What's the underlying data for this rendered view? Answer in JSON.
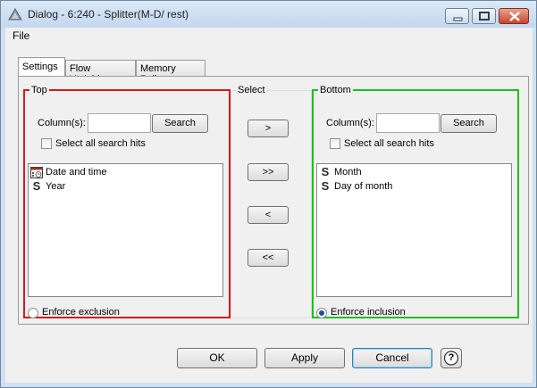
{
  "window": {
    "title": "Dialog - 6:240 - Splitter(M-D/ rest)"
  },
  "menu": {
    "file": "File"
  },
  "tabs": [
    "Settings",
    "Flow Variables",
    "Memory Policy"
  ],
  "top": {
    "legend": "Top",
    "column_label": "Column(s):",
    "search_value": "",
    "search_button": "Search",
    "select_all": "Select all search hits",
    "items": [
      {
        "label": "Date and time",
        "icon": "calendar-icon"
      },
      {
        "label": "Year",
        "icon": "string-type-icon"
      }
    ],
    "enforce": "Enforce exclusion"
  },
  "select": {
    "legend": "Select",
    "buttons": [
      ">",
      ">>",
      "<",
      "<<"
    ]
  },
  "bottom": {
    "legend": "Bottom",
    "column_label": "Column(s):",
    "search_value": "",
    "search_button": "Search",
    "select_all": "Select all search hits",
    "items": [
      {
        "label": "Month",
        "icon": "string-type-icon"
      },
      {
        "label": "Day of month",
        "icon": "string-type-icon"
      }
    ],
    "enforce": "Enforce inclusion"
  },
  "footer": {
    "ok": "OK",
    "apply": "Apply",
    "cancel": "Cancel",
    "help": "?"
  },
  "colors": {
    "top_border": "#d51a1a",
    "bottom_border": "#18c318",
    "focus_blue": "#3c7fb1"
  }
}
